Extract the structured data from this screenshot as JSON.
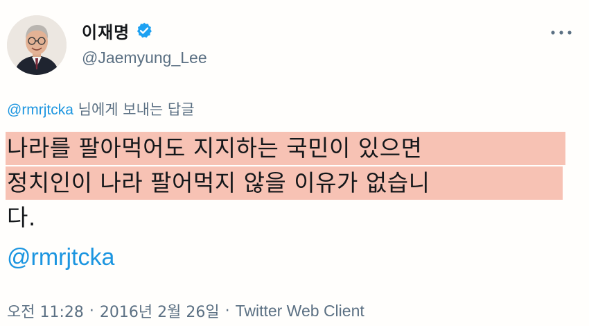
{
  "tweet": {
    "author": {
      "display_name": "이재명",
      "handle": "@Jaemyung_Lee",
      "verified_icon": "verified-badge-icon",
      "avatar_icon": "profile-photo"
    },
    "more_icon": "more-options-icon",
    "reply_to": {
      "mention": "@rmrjtcka",
      "suffix": " 님에게 보내는 답글"
    },
    "text_lines": [
      "나라를 팔아먹어도 지지하는 국민이 있으면",
      "정치인이 나라 팔어먹지 않을 이유가 없습니",
      "다."
    ],
    "mention_line": "@rmrjtcka",
    "meta": {
      "time": "오전 11:28",
      "separator": "·",
      "date": "2016년 2월 26일",
      "source": "Twitter Web Client"
    },
    "colors": {
      "highlight": "#f7c2b4",
      "link": "#1b95e0",
      "verified": "#1da1f2",
      "secondary_text": "#5b7083"
    }
  }
}
